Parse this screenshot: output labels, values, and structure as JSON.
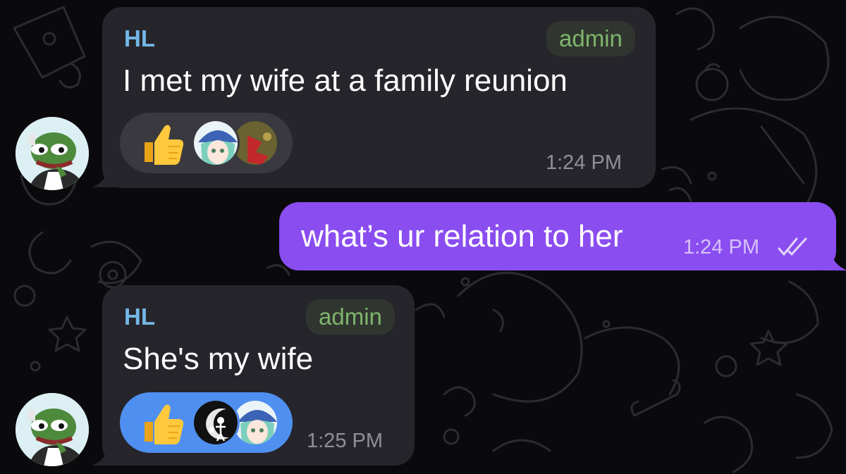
{
  "chat": {
    "messages": [
      {
        "direction": "incoming",
        "sender": "HL",
        "role": "admin",
        "text": "I met my wife at a family reunion",
        "time": "1:24 PM",
        "reaction": {
          "emoji": "thumbs-up-icon",
          "state": "not-selected",
          "reactors": [
            "anime-girl-blue-hat-avatar",
            "red-leaf-avatar"
          ]
        }
      },
      {
        "direction": "outgoing",
        "text": "what’s ur relation to her",
        "time": "1:24 PM",
        "status": "read-double-check-icon"
      },
      {
        "direction": "incoming",
        "sender": "HL",
        "role": "admin",
        "text": "She's my wife",
        "time": "1:25 PM",
        "reaction": {
          "emoji": "thumbs-up-icon",
          "state": "selected",
          "reactors": [
            "skeleton-moon-avatar",
            "anime-girl-blue-hat-avatar"
          ]
        }
      }
    ]
  },
  "colors": {
    "background": "#0a0a0d",
    "incoming_bubble": "#26252b",
    "outgoing_bubble": "#8a4df0",
    "sender_name": "#74b7e6",
    "admin_badge_text": "#7fb56d",
    "reaction_selected": "#4f8ff0"
  }
}
